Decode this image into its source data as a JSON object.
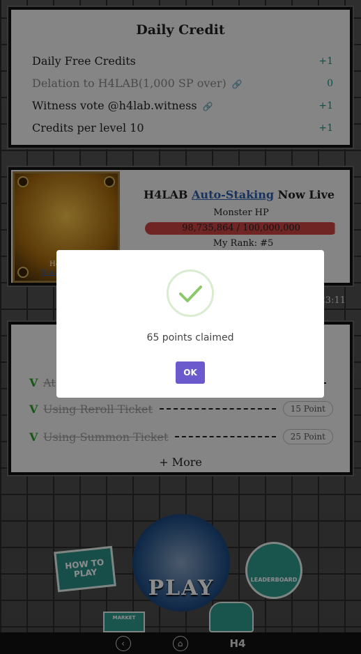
{
  "daily_credit": {
    "title": "Daily Credit",
    "rows": [
      {
        "label": "Daily Free Credits",
        "value": "+1"
      },
      {
        "label": "Delation to H4LAB(1,000 SP over)",
        "value": "0"
      },
      {
        "label": "Witness vote @h4lab.witness",
        "value": "+1"
      },
      {
        "label": "Credits per level 10",
        "value": "+1"
      }
    ]
  },
  "staking": {
    "brand": "H4LAB",
    "link": "Auto-Staking",
    "suffix": "Now Live",
    "monster_label": "Monster HP",
    "hp_text": "98,735,864 / 100,000,000",
    "hp_fraction": 0.987,
    "rank": "My Rank: #5",
    "portrait_caption": "H4",
    "portrait_link": "Staki"
  },
  "timer": "3:23:11",
  "missions": {
    "items": [
      {
        "check": "V",
        "label": "At",
        "points": ""
      },
      {
        "check": "V",
        "label": "Using Reroll Ticket",
        "points": "15 Point"
      },
      {
        "check": "V",
        "label": "Using Summon Ticket",
        "points": "25 Point"
      }
    ],
    "more": "+ More"
  },
  "modal": {
    "message": "65 points claimed",
    "ok": "OK"
  },
  "play": {
    "how_to": "HOW TO PLAY",
    "play": "PLAY",
    "leaderboard": "LEADERBOARD",
    "market": "MARKET"
  },
  "navbar": {
    "back_icon": "chevron-left-icon",
    "home_icon": "home-icon",
    "logo": "H4"
  },
  "colors": {
    "accent": "#1d8f8a",
    "ok_button": "#6a5acd",
    "hp_bar": "#cc4444",
    "check_green": "#2a9d2a"
  }
}
